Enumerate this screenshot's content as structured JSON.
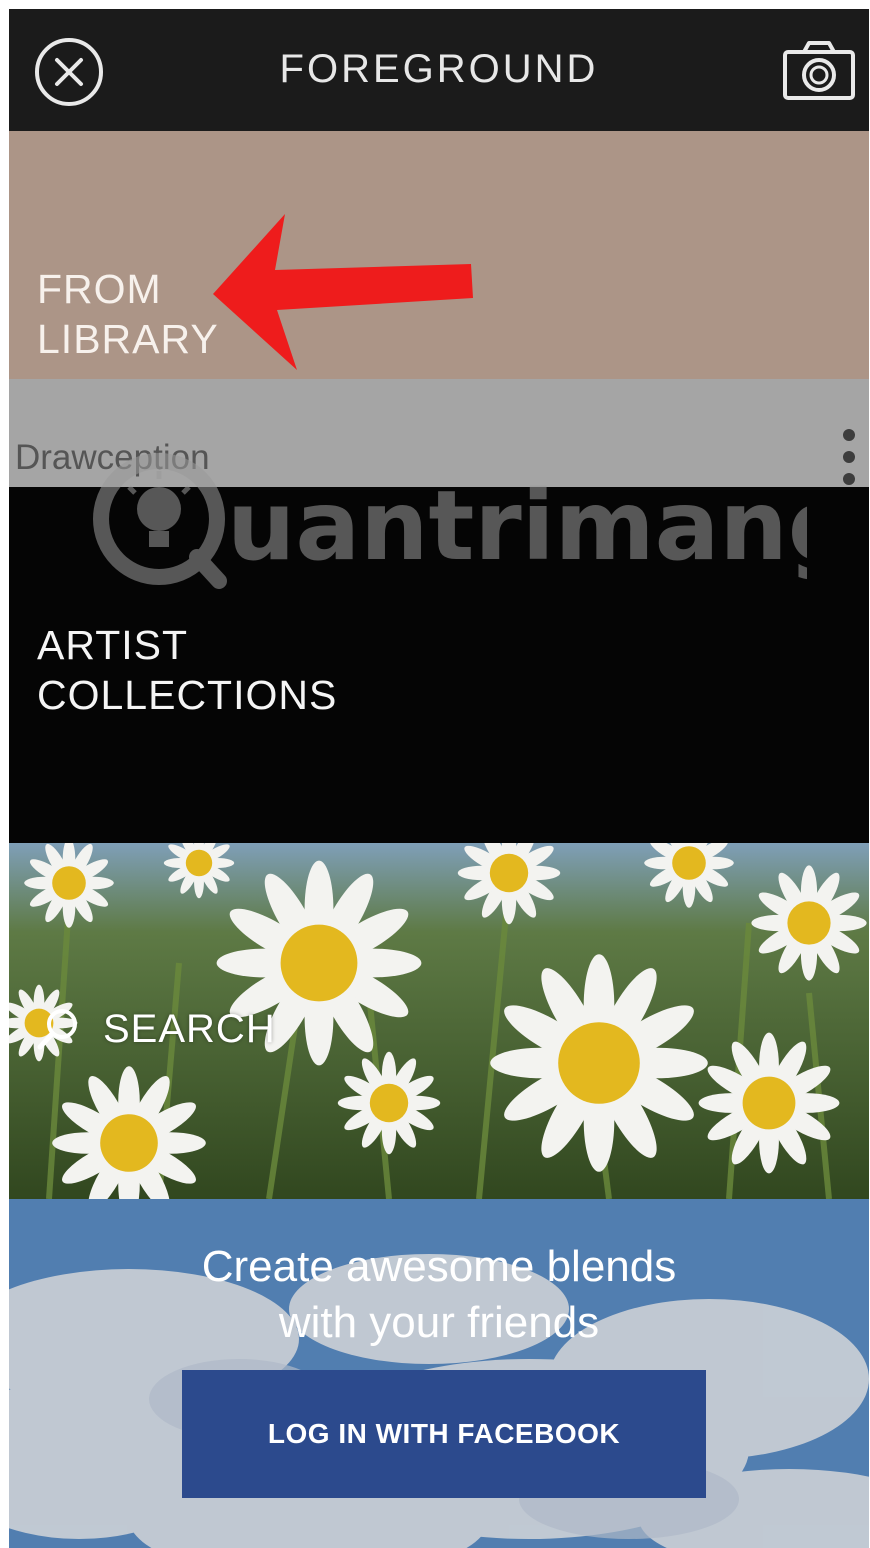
{
  "header": {
    "title": "FOREGROUND",
    "close_icon": "close-circle-icon",
    "camera_icon": "camera-icon"
  },
  "library": {
    "line1": "FROM",
    "line2": "LIBRARY",
    "annotation": "red-arrow-pointing-left"
  },
  "drawception": {
    "label": "Drawception",
    "menu_icon": "vertical-dots-icon"
  },
  "artist": {
    "line1": "ARTIST",
    "line2": "COLLECTIONS"
  },
  "watermark": {
    "text": "uantrimang"
  },
  "search": {
    "label": "SEARCH",
    "icon": "search-icon"
  },
  "promo": {
    "line1": "Create awesome blends",
    "line2": "with your friends",
    "button_label": "LOG IN WITH FACEBOOK"
  },
  "colors": {
    "header_bg": "#1b1b1b",
    "library_bg": "#ac9587",
    "drawception_bg": "#a5a5a5",
    "artist_bg": "#050505",
    "facebook_blue": "#2c4a8d",
    "arrow_red": "#ee1c1c"
  }
}
